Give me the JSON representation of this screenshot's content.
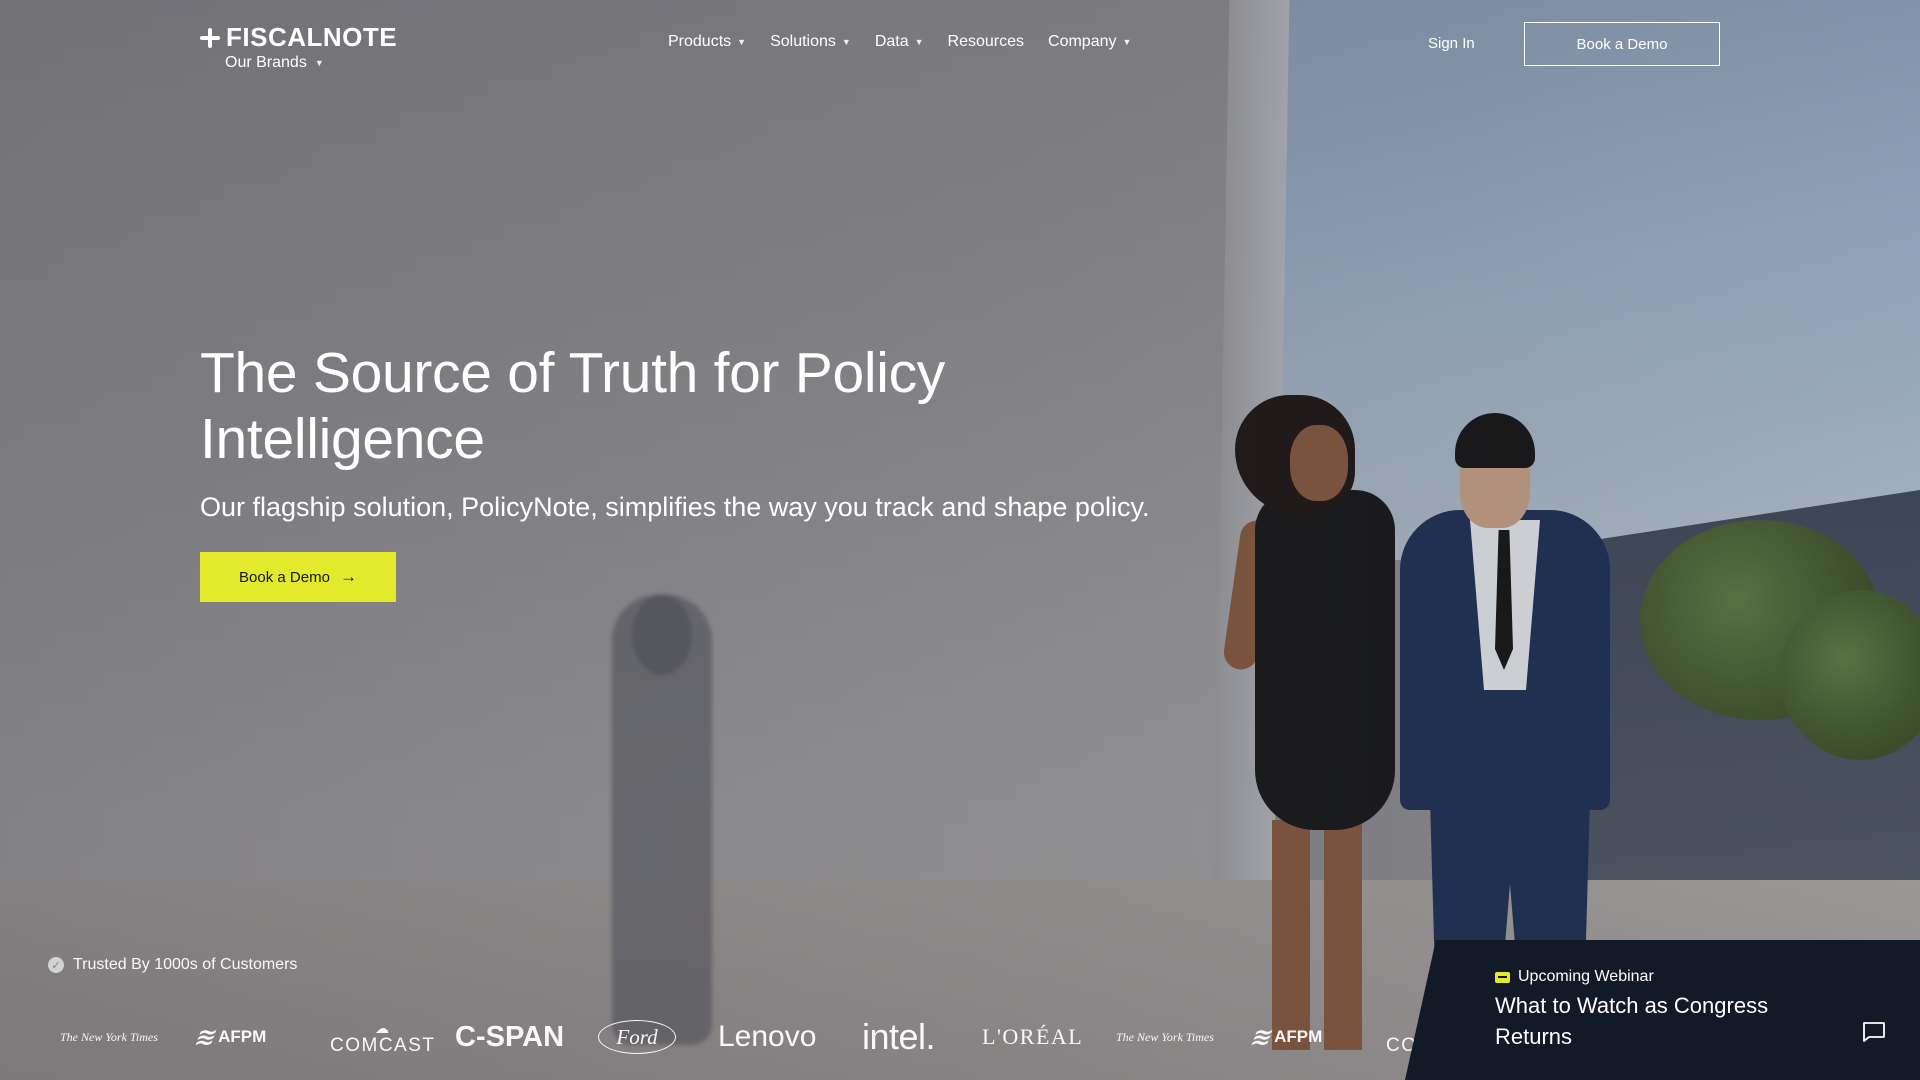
{
  "brand": {
    "logo_text": "FISCALNOTE",
    "brands_label": "Our Brands"
  },
  "nav": {
    "items": [
      {
        "label": "Products",
        "has_dropdown": true
      },
      {
        "label": "Solutions",
        "has_dropdown": true
      },
      {
        "label": "Data",
        "has_dropdown": true
      },
      {
        "label": "Resources",
        "has_dropdown": false
      },
      {
        "label": "Company",
        "has_dropdown": true
      }
    ],
    "sign_in": "Sign In",
    "book_demo": "Book a Demo"
  },
  "hero": {
    "title_line1": "The Source of Truth for Policy",
    "title_line2": "Intelligence",
    "subtitle": "Our flagship solution, PolicyNote, simplifies the way you track and shape policy.",
    "cta_label": "Book a Demo"
  },
  "trusted": {
    "label": "Trusted By 1000s of Customers",
    "logos": [
      "The New York Times",
      "AFPM",
      "COMCAST",
      "C-SPAN",
      "Ford",
      "Lenovo",
      "intel.",
      "L'ORÉAL",
      "The New York Times",
      "AFPM",
      "COMCAST"
    ]
  },
  "webinar": {
    "tag": "Upcoming Webinar",
    "title": "What to Watch as Congress Returns"
  },
  "colors": {
    "accent": "#e3ea2c",
    "dark_panel": "#131a27",
    "text": "#ffffff"
  },
  "icons": {
    "logo_mark": "plus-star-icon",
    "dropdown": "caret-down-icon",
    "cta_arrow": "arrow-right-icon",
    "trusted_check": "check-circle-icon",
    "webinar_tag": "ticket-icon",
    "chat": "chat-bubble-icon"
  }
}
